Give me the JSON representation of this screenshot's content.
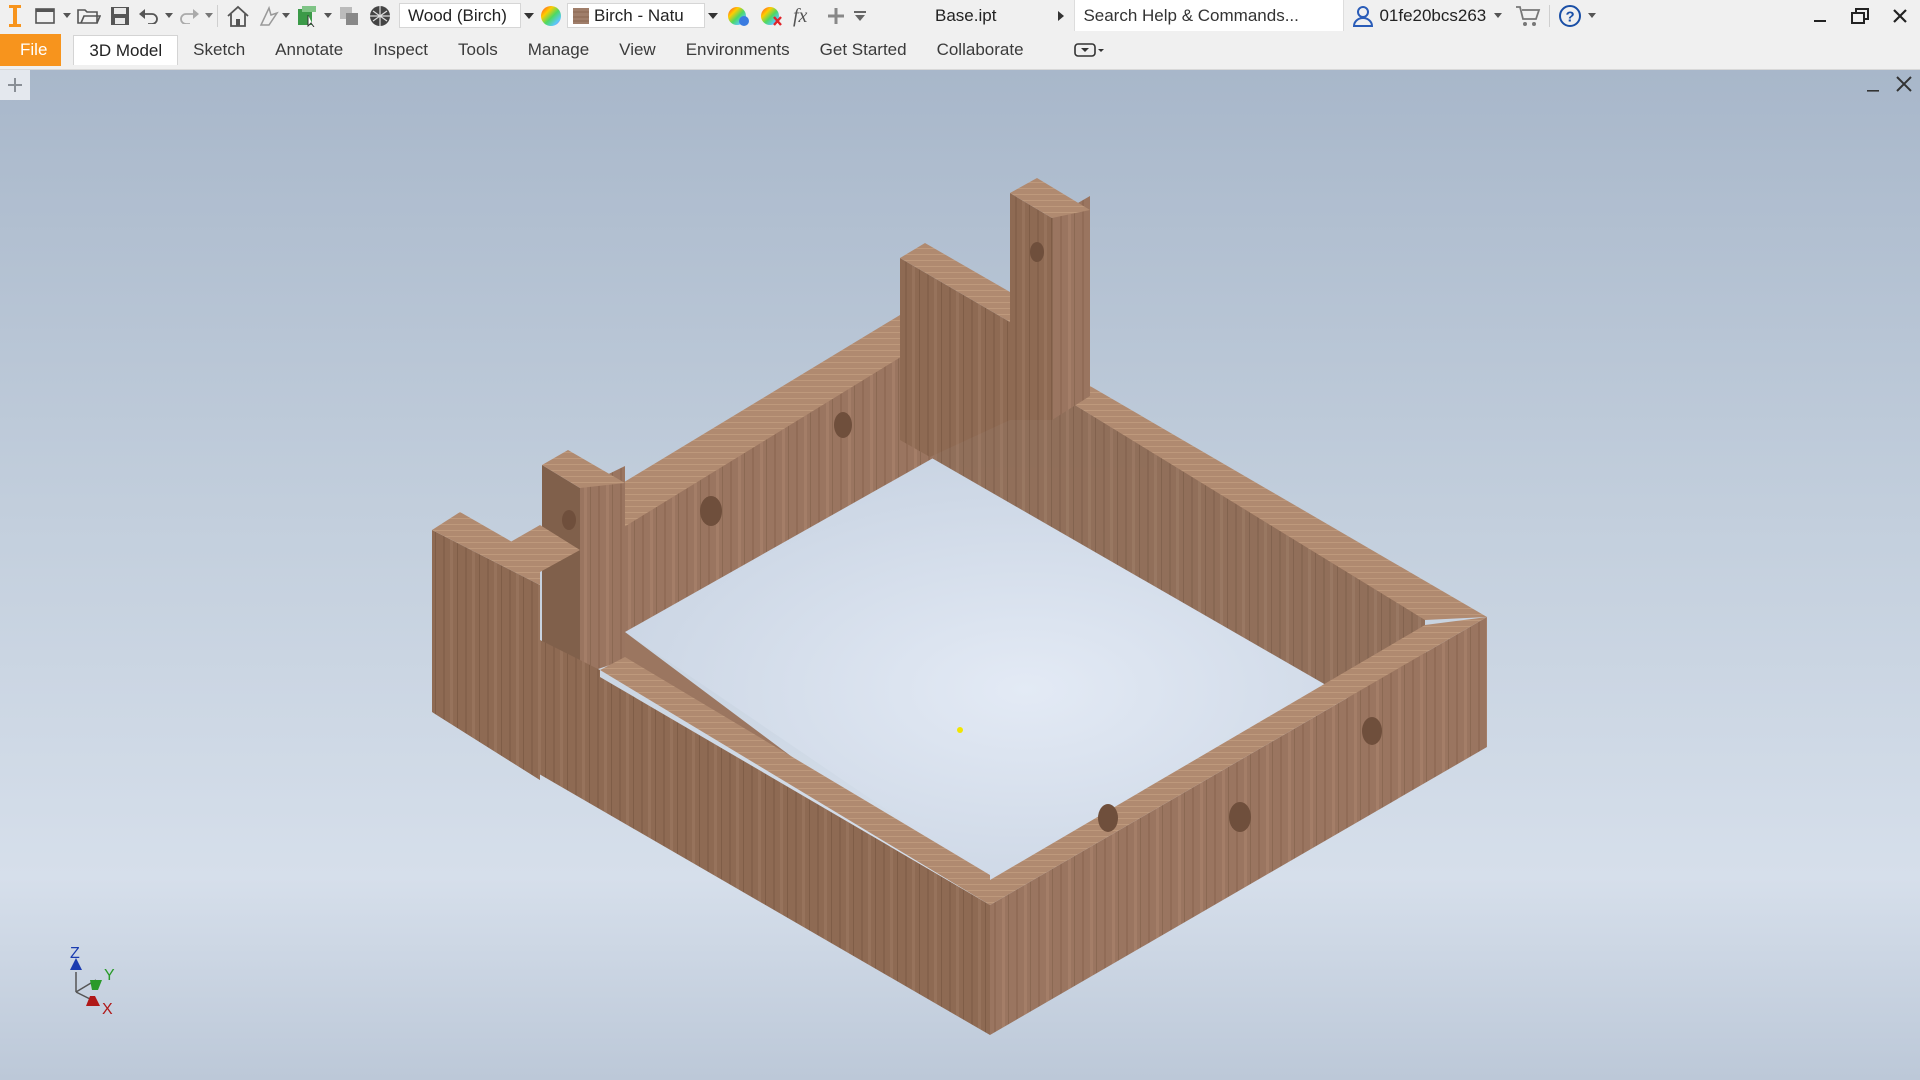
{
  "title_bar": {
    "app_logo": "inventor-logo",
    "material_combo": {
      "value": "Wood (Birch)"
    },
    "appearance_combo": {
      "value": "Birch - Natu"
    },
    "document_name": "Base.ipt",
    "search_placeholder": "Search Help & Commands...",
    "user_name": "01fe20bcs263",
    "icons": [
      "new-icon",
      "open-icon",
      "save-icon",
      "undo-icon",
      "redo-icon",
      "home-icon",
      "update-icon",
      "select-icon",
      "display-icon",
      "material-icon",
      "appearance-color-icon",
      "material-texture-icon",
      "adjust-appearance-icon",
      "clear-appearance-icon",
      "fx-parameters-icon",
      "add-icon",
      "customize-icon",
      "user-icon",
      "cart-icon",
      "help-icon",
      "minimize-icon",
      "restore-icon",
      "close-icon"
    ]
  },
  "ribbon": {
    "tabs": [
      {
        "id": "file",
        "label": "File"
      },
      {
        "id": "3d-model",
        "label": "3D Model"
      },
      {
        "id": "sketch",
        "label": "Sketch"
      },
      {
        "id": "annotate",
        "label": "Annotate"
      },
      {
        "id": "inspect",
        "label": "Inspect"
      },
      {
        "id": "tools",
        "label": "Tools"
      },
      {
        "id": "manage",
        "label": "Manage"
      },
      {
        "id": "view",
        "label": "View"
      },
      {
        "id": "environments",
        "label": "Environments"
      },
      {
        "id": "get-started",
        "label": "Get Started"
      },
      {
        "id": "collaborate",
        "label": "Collaborate"
      }
    ],
    "active_tab": "3D Model"
  },
  "viewport": {
    "triad": {
      "z": "Z",
      "y": "Y",
      "x": "X"
    }
  },
  "colors": {
    "file_tab": "#f7941d",
    "wood_light": "#b08a6f",
    "wood_mid": "#946d55",
    "wood_dark": "#7a5845",
    "axis_x": "#b01818",
    "axis_y": "#2a9a2a",
    "axis_z": "#1a3bb0"
  }
}
